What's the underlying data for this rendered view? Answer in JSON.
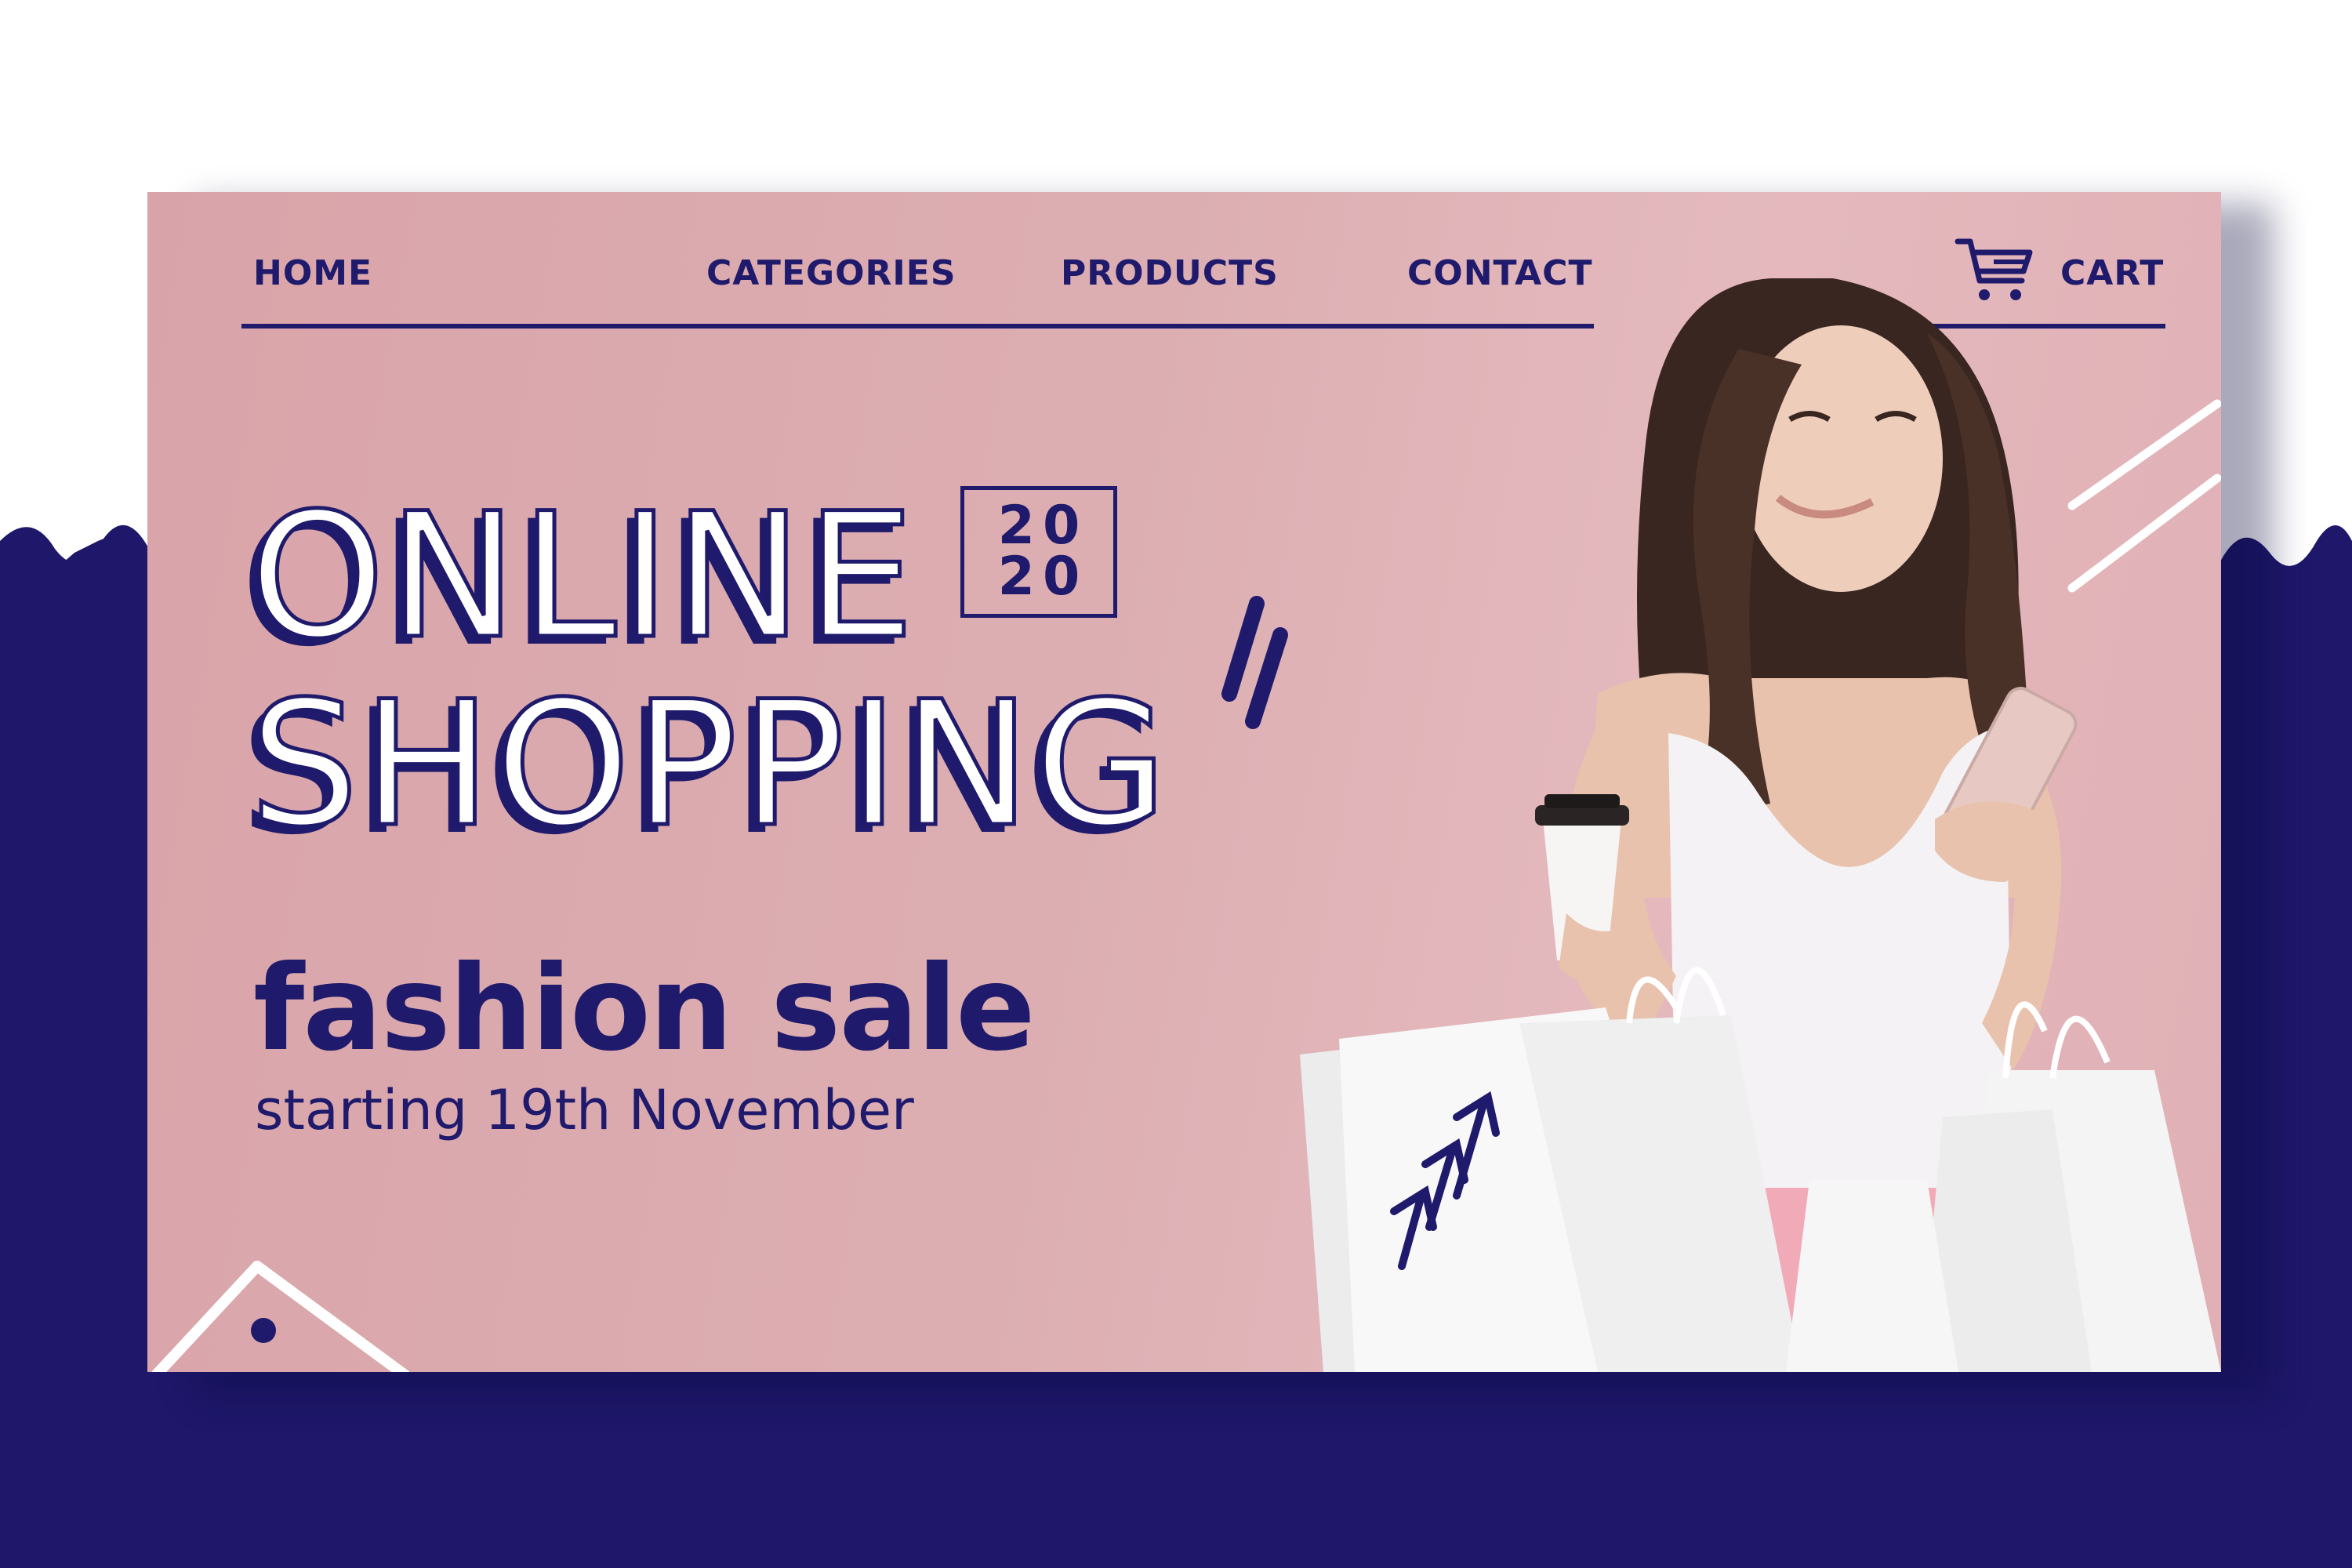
{
  "nav": {
    "home": "HOME",
    "categories": "CATEGORIES",
    "products": "PRODUCTS",
    "contact": "CONTACT",
    "cart": "CART"
  },
  "hero": {
    "headline_line1": "ONLINE",
    "headline_line2": "SHOPPING",
    "year_top": "20",
    "year_bottom": "20",
    "sale_title": "fashion sale",
    "sale_subtitle": "starting 19th November",
    "photo_subject": "smiling woman holding coffee cup, smartphone and white shopping bags"
  },
  "icons": {
    "cart": "shopping-cart-icon"
  },
  "colors": {
    "navy": "#1f1a6b",
    "pink": "#dcaeb2",
    "white": "#ffffff"
  }
}
